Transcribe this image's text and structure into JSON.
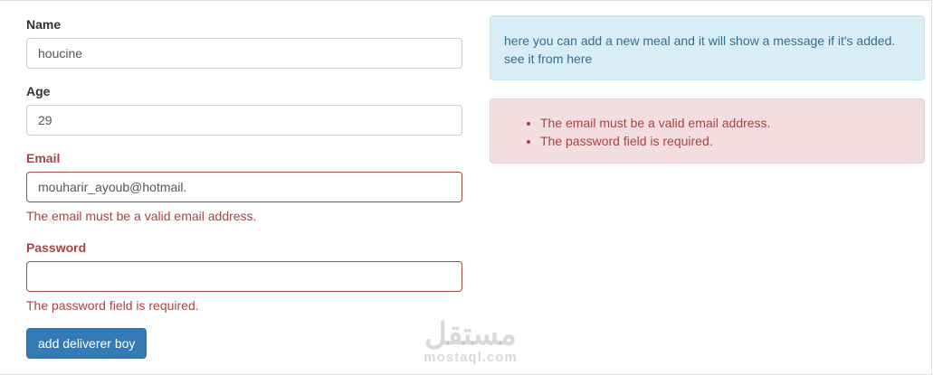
{
  "form": {
    "name": {
      "label": "Name",
      "value": "houcine"
    },
    "age": {
      "label": "Age",
      "value": "29"
    },
    "email": {
      "label": "Email",
      "value": "mouharir_ayoub@hotmail.",
      "error": "The email must be a valid email address."
    },
    "password": {
      "label": "Password",
      "value": "",
      "error": "The password field is required."
    },
    "submit_label": "add deliverer boy"
  },
  "info_alert": {
    "line1": "here you can add a new meal and it will show a message if it's added.",
    "line2": "see it from here"
  },
  "error_alert": {
    "items": [
      "The email must be a valid email address.",
      "The password field is required."
    ]
  },
  "watermark": {
    "logo": "مستقل",
    "text": "mostaql.com"
  },
  "colors": {
    "primary": "#337ab7",
    "error": "#a94442",
    "info_bg": "#d9edf7",
    "info_text": "#31708f",
    "danger_bg": "#f2dede"
  }
}
